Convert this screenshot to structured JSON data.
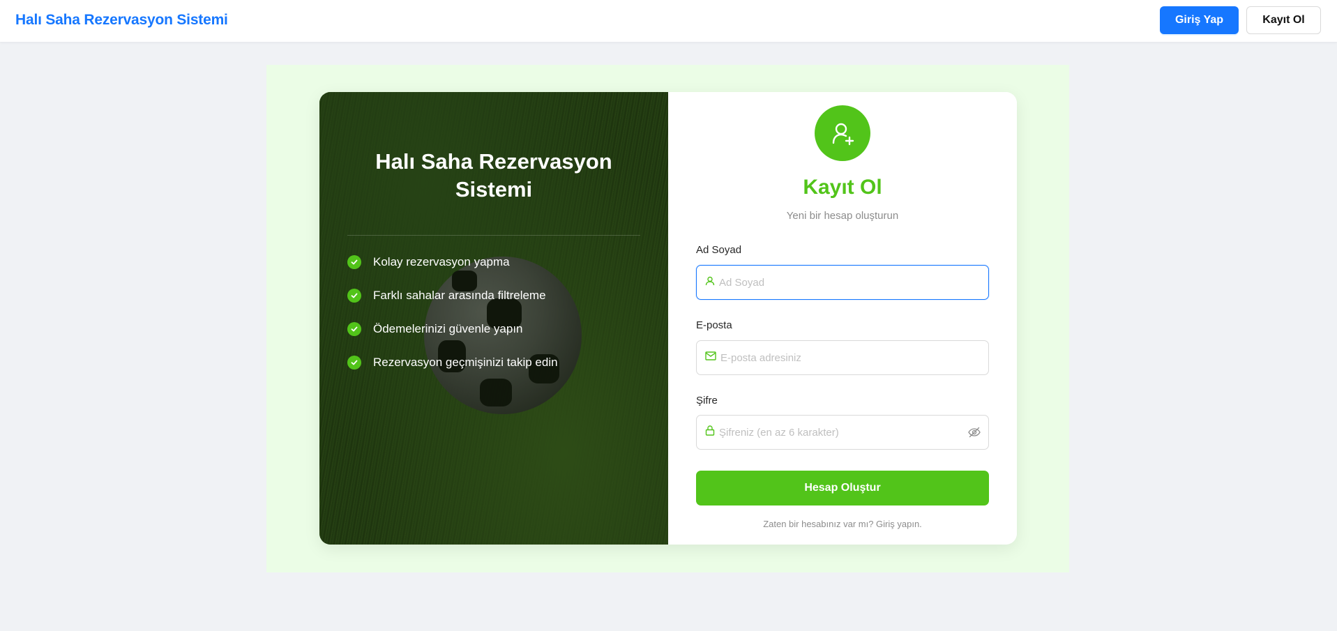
{
  "header": {
    "brand": "Halı Saha Rezervasyon Sistemi",
    "login_label": "Giriş Yap",
    "register_label": "Kayıt Ol"
  },
  "hero": {
    "title": "Halı Saha Rezervasyon Sistemi",
    "features": [
      "Kolay rezervasyon yapma",
      "Farklı sahalar arasında filtreleme",
      "Ödemelerinizi güvenle yapın",
      "Rezervasyon geçmişinizi takip edin"
    ]
  },
  "form": {
    "title": "Kayıt Ol",
    "subtitle": "Yeni bir hesap oluşturun",
    "fields": {
      "name": {
        "label": "Ad Soyad",
        "placeholder": "Ad Soyad",
        "value": ""
      },
      "email": {
        "label": "E-posta",
        "placeholder": "E-posta adresiniz",
        "value": ""
      },
      "password": {
        "label": "Şifre",
        "placeholder": "Şifreniz (en az 6 karakter)",
        "value": ""
      }
    },
    "submit_label": "Hesap Oluştur",
    "login_hint": "Zaten bir hesabınız var mı? Giriş yapın."
  },
  "colors": {
    "primary": "#1677ff",
    "accent": "#52c41a",
    "background": "#f0f2f5",
    "wrapper": "#ebfde6"
  },
  "icons": {
    "avatar": "user-add-icon",
    "name_field": "user-icon",
    "email_field": "mail-icon",
    "password_field": "lock-icon",
    "password_toggle": "eye-invisible-icon",
    "feature": "check-circle-icon"
  }
}
